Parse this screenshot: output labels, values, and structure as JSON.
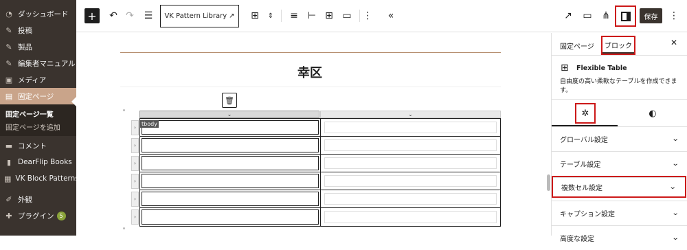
{
  "sidebar": {
    "items": [
      {
        "label": "ダッシュボード",
        "icon": "dashboard-icon",
        "glyph": "◔"
      },
      {
        "label": "投稿",
        "icon": "pin-icon",
        "glyph": "✎"
      },
      {
        "label": "製品",
        "icon": "pin-icon",
        "glyph": "✎"
      },
      {
        "label": "編集者マニュアル",
        "icon": "pin-icon",
        "glyph": "✎"
      },
      {
        "label": "メディア",
        "icon": "media-icon",
        "glyph": "▣"
      },
      {
        "label": "固定ページ",
        "icon": "page-icon",
        "glyph": "▤"
      }
    ],
    "sub_items": [
      "固定ページ一覧",
      "固定ページを追加"
    ],
    "items_after": [
      {
        "label": "コメント",
        "icon": "comment-icon",
        "glyph": "▬"
      },
      {
        "label": "DearFlip Books",
        "icon": "book-icon",
        "glyph": "▮"
      },
      {
        "label": "VK Block Patterns",
        "icon": "grid-icon",
        "glyph": "▦"
      },
      {
        "label": "外観",
        "icon": "brush-icon",
        "glyph": "✐"
      },
      {
        "label": "プラグイン",
        "icon": "plugin-icon",
        "glyph": "✚",
        "badge": "5"
      }
    ]
  },
  "toolbar": {
    "pattern_library": "VK Pattern Library",
    "save_label": "保存"
  },
  "canvas": {
    "page_title": "幸区",
    "tbody_label": "tbody",
    "rows": 6
  },
  "panel": {
    "tab_page": "固定ページ",
    "tab_block": "ブロック",
    "block_name": "Flexible Table",
    "block_desc": "自由度の高い柔軟なテーブルを作成できます。",
    "sections": [
      "グローバル設定",
      "テーブル設定",
      "複数セル設定",
      "キャプション設定",
      "高度な設定"
    ]
  },
  "colors": {
    "sidebar_bg": "#3a332e",
    "sidebar_active": "#c9a48a",
    "highlight_red": "#cc1818"
  }
}
